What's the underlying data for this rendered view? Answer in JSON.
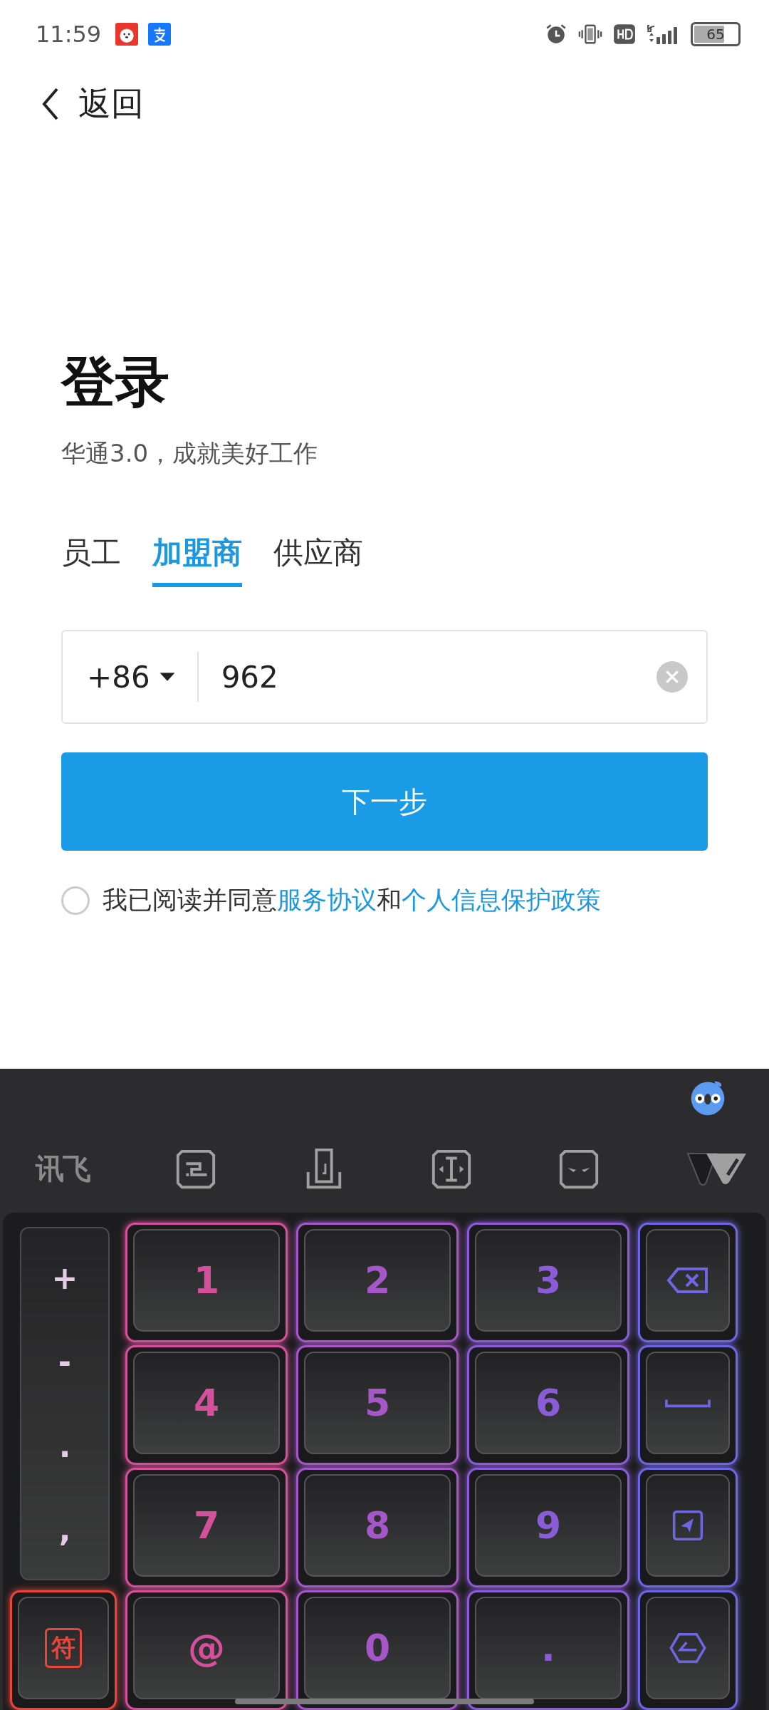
{
  "status_bar": {
    "time": "11:59",
    "battery": "65"
  },
  "header": {
    "back_label": "返回"
  },
  "title": "登录",
  "subtitle": "华通3.0，成就美好工作",
  "tabs": [
    {
      "label": "员工",
      "selected": false
    },
    {
      "label": "加盟商",
      "selected": true
    },
    {
      "label": "供应商",
      "selected": false
    }
  ],
  "phone_field": {
    "country_code": "+86",
    "value": "962"
  },
  "next_button": "下一步",
  "agreement": {
    "checked": false,
    "text": "我已阅读并同意",
    "link_1": "服务协议",
    "joiner": "和",
    "link_2": "个人信息保护政策"
  },
  "keyboard": {
    "logo": "讯飞",
    "side_keys": [
      "+",
      "-",
      ".",
      ","
    ],
    "keys": [
      {
        "kind": "text",
        "label": "1"
      },
      {
        "kind": "text",
        "label": "2"
      },
      {
        "kind": "text",
        "label": "3"
      },
      {
        "kind": "backspace"
      },
      {
        "kind": "text",
        "label": "4"
      },
      {
        "kind": "text",
        "label": "5"
      },
      {
        "kind": "text",
        "label": "6"
      },
      {
        "kind": "space"
      },
      {
        "kind": "text",
        "label": "7"
      },
      {
        "kind": "text",
        "label": "8"
      },
      {
        "kind": "text",
        "label": "9"
      },
      {
        "kind": "send"
      },
      {
        "kind": "symbol",
        "label": "符"
      },
      {
        "kind": "text",
        "label": "@"
      },
      {
        "kind": "text",
        "label": "0"
      },
      {
        "kind": "text",
        "label": "."
      },
      {
        "kind": "enter"
      }
    ]
  }
}
